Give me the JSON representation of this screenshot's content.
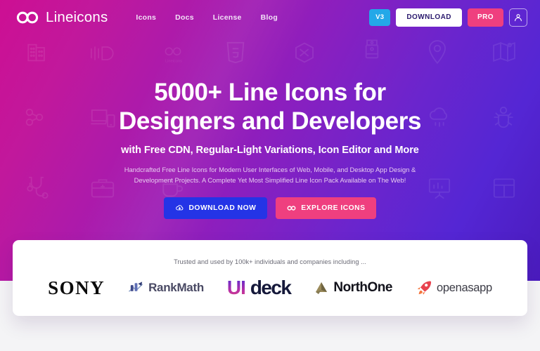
{
  "header": {
    "brand": {
      "name": "Lineicons",
      "mark_icon": "infinity-icon"
    },
    "nav": [
      {
        "label": "Icons"
      },
      {
        "label": "Docs"
      },
      {
        "label": "License"
      },
      {
        "label": "Blog"
      }
    ],
    "actions": {
      "version_badge": "V3",
      "download_label": "DOWNLOAD",
      "pro_label": "PRO",
      "account_icon": "user-icon"
    },
    "colors": {
      "v3_badge": "#23a8e8",
      "download_bg": "#ffffff",
      "pro_bg": "#ef3f7f"
    }
  },
  "hero": {
    "headline_line1": "5000+ Line Icons for",
    "headline_line2": "Designers and Developers",
    "subhead": "with Free CDN, Regular-Light Variations, Icon Editor and More",
    "description": "Handcrafted Free Line Icons for Modern User Interfaces of Web, Mobile, and Desktop App Design & Development Projects. A Complete Yet Most Simplified Line Icon Pack Available on The Web!",
    "cta_primary": {
      "label": "DOWNLOAD NOW",
      "icon": "cloud-download-icon",
      "color": "#2434e6"
    },
    "cta_secondary": {
      "label": "EXPLORE ICONS",
      "icon": "infinity-icon",
      "color": "#ef3f7f"
    },
    "gradient_from": "#cd0f93",
    "gradient_to": "#4a1bbd"
  },
  "trusted": {
    "label": "Trusted and used by 100k+ individuals and companies including ...",
    "logos": [
      {
        "name": "SONY",
        "icon": ""
      },
      {
        "name": "RankMath",
        "icon": "bar-chart-icon"
      },
      {
        "name_primary": "UI",
        "name_secondary": "deck",
        "icon": ""
      },
      {
        "name": "NorthOne",
        "icon": "triangle-mark-icon"
      },
      {
        "name": "openasapp",
        "icon": "rocket-icon"
      }
    ]
  },
  "background_icons": [
    "building-icon",
    "sliders-icon",
    "lineicons-logo-icon",
    "html5-icon",
    "hexagon-icon",
    "water-dispenser-icon",
    "map-pin-icon",
    "map-icon",
    "share-nodes-icon",
    "devices-icon",
    "cloud-rain-icon",
    "bug-icon",
    "stethoscope-icon",
    "briefcase-medical-icon",
    "coffee-icon",
    "presentation-icon",
    "layout-icon"
  ]
}
